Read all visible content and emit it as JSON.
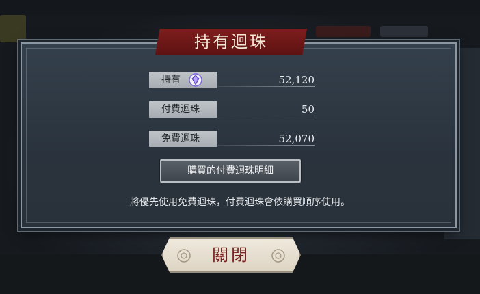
{
  "dialog": {
    "title": "持有迴珠",
    "rows": [
      {
        "label": "持有",
        "value": "52,120",
        "icon": "orb-gem-icon"
      },
      {
        "label": "付費迴珠",
        "value": "50"
      },
      {
        "label": "免費迴珠",
        "value": "52,070"
      }
    ],
    "detail_button_label": "購買的付費迴珠明細",
    "notice": "將優先使用免費迴珠，付費迴珠會依購買順序使用。",
    "close_button_label": "關閉"
  },
  "colors": {
    "title_banner": "#6e1717",
    "close_text": "#7a1e1e",
    "label_bg": "#b5babe",
    "orb_gem": "#8a6cf0"
  }
}
